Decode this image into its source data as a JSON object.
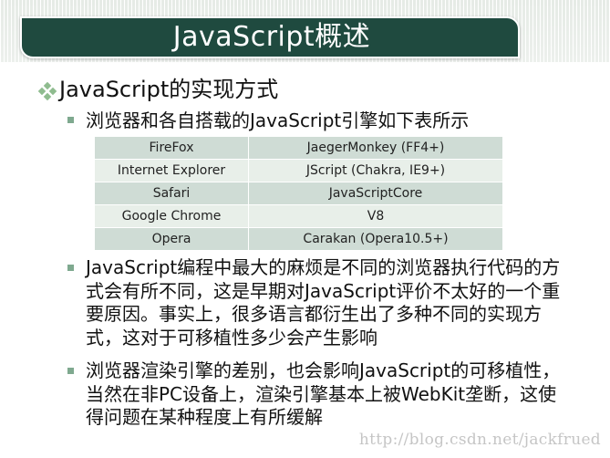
{
  "slide": {
    "title": "JavaScript概述",
    "section_heading": "JavaScript的实现方式",
    "bullets": [
      "浏览器和各自搭载的JavaScript引擎如下表所示",
      "JavaScript编程中最大的麻烦是不同的浏览器执行代码的方式会有所不同，这是早期对JavaScript评价不太好的一个重要原因。事实上，很多语言都衍生出了多种不同的实现方式，这对于可移植性多少会产生影响",
      "浏览器渲染引擎的差别，也会影响JavaScript的可移植性，当然在非PC设备上，渲染引擎基本上被WebKit垄断，这使得问题在某种程度上有所缓解"
    ],
    "engine_table": [
      {
        "browser": "FireFox",
        "engine": "JaegerMonkey (FF4+)"
      },
      {
        "browser": "Internet Explorer",
        "engine": "JScript (Chakra, IE9+)"
      },
      {
        "browser": "Safari",
        "engine": "JavaScriptCore"
      },
      {
        "browser": "Google Chrome",
        "engine": "V8"
      },
      {
        "browser": "Opera",
        "engine": "Carakan (Opera10.5+)"
      }
    ]
  },
  "watermark": "http://blog.csdn.net/jackfrued",
  "colors": {
    "title_bar": "#1f4a3f",
    "bullet_accent": "#7fa98f",
    "table_row_dark": "#cfdcd5",
    "table_row_light": "#e8efe9"
  },
  "icons": {
    "section_bullet": "four-diamond-icon",
    "item_bullet": "square-bullet-icon"
  }
}
